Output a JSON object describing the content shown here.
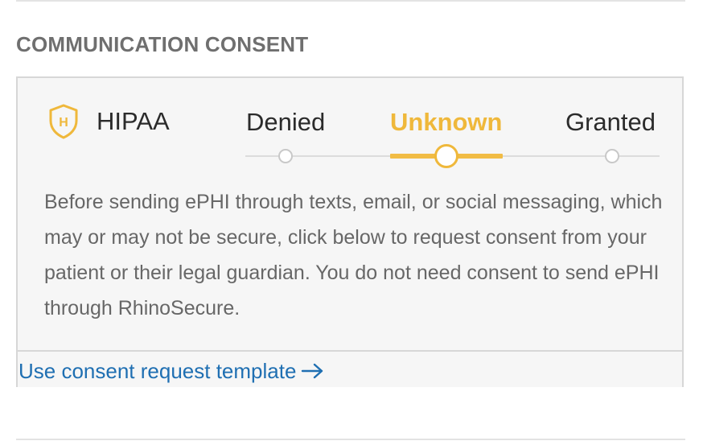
{
  "section": {
    "title": "COMMUNICATION CONSENT"
  },
  "consent": {
    "label": "HIPAA",
    "icon": "hipaa-shield-icon",
    "icon_letter": "H",
    "options": [
      "Denied",
      "Unknown",
      "Granted"
    ],
    "selected": "Unknown",
    "accent_color": "#efb83b",
    "description": "Before sending ePHI through texts, email, or social messaging, which may or may not be secure, click below to request consent from your patient or their legal guardian. You do not need consent to send ePHI through RhinoSecure."
  },
  "footer": {
    "link_label": "Use consent request template",
    "link_icon": "arrow-right-icon",
    "link_color": "#1f6fb2"
  }
}
